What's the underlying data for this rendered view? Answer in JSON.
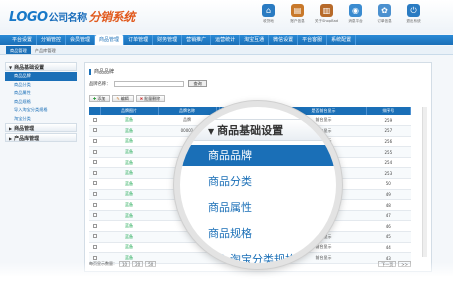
{
  "header": {
    "logo_main": "LOGO",
    "logo_company": "公司名称",
    "logo_system": "分销系统"
  },
  "top_icons": [
    {
      "label": "收货地",
      "icon": "home-icon",
      "color": "#2a7bc2",
      "glyph": "⌂"
    },
    {
      "label": "账户信息",
      "icon": "chart-icon",
      "color": "#c8782a",
      "glyph": "▤"
    },
    {
      "label": "关于ShopBad",
      "icon": "book-icon",
      "color": "#b76a2a",
      "glyph": "▥"
    },
    {
      "label": "消息平台",
      "icon": "globe-icon",
      "color": "#3a8bd0",
      "glyph": "◉"
    },
    {
      "label": "订单信息",
      "icon": "gear-icon",
      "color": "#4b90cf",
      "glyph": "✿"
    },
    {
      "label": "退出系统",
      "icon": "power-icon",
      "color": "#2a7bc2",
      "glyph": "⏻"
    }
  ],
  "nav": [
    "平台设置",
    "分销管控",
    "会员管理",
    "商品管理",
    "订单管理",
    "财务管理",
    "营销推广",
    "运营统计",
    "淘宝互通",
    "微信设置",
    "平台客服",
    "系统配置"
  ],
  "subnav": [
    "商品管理",
    "产品库管理"
  ],
  "sidebar": {
    "groups": [
      {
        "title": "商品基础设置",
        "items": [
          "商品品牌",
          "商品分类",
          "商品属性",
          "商品规格",
          "导入淘宝分类规格",
          "淘宝分类"
        ]
      },
      {
        "title": "商品管理",
        "items": []
      },
      {
        "title": "产品库管理",
        "items": []
      }
    ]
  },
  "main": {
    "title": "商品品牌",
    "search_label": "品牌名称：",
    "search_button": "查询",
    "toolbar": {
      "add": "添加",
      "edit": "编辑",
      "delete": "批量删除"
    },
    "columns": [
      "",
      "品牌图片",
      "品牌名称",
      "",
      "",
      "是否推荐",
      "是否前台显示",
      "排序号"
    ],
    "rows": [
      [
        "",
        "蓝备",
        "品牌",
        "",
        "",
        "推荐",
        "前台显示",
        "259"
      ],
      [
        "",
        "蓝备",
        "00001",
        "",
        "",
        "",
        "前台显示",
        "257"
      ],
      [
        "",
        "蓝备",
        "",
        "",
        "",
        "",
        "前台显示",
        "256"
      ],
      [
        "",
        "蓝备",
        "珊",
        "",
        "",
        "",
        "前台显示",
        "255"
      ],
      [
        "",
        "蓝备",
        "",
        "",
        "",
        "",
        "前台显示",
        "254"
      ],
      [
        "",
        "蓝备",
        "",
        "",
        "",
        "",
        "前台显示",
        "253"
      ],
      [
        "",
        "蓝备",
        "",
        "",
        "",
        "",
        "前台显示",
        "50"
      ],
      [
        "",
        "蓝备",
        "",
        "",
        "",
        "",
        "前台显示",
        "49"
      ],
      [
        "",
        "蓝备",
        "",
        "",
        "",
        "",
        "前台显示",
        "48"
      ],
      [
        "",
        "蓝备",
        "",
        "",
        "",
        "",
        "前台显示",
        "47"
      ],
      [
        "",
        "蓝备",
        "",
        "",
        "",
        "",
        "前台显示",
        "46"
      ],
      [
        "",
        "蓝备",
        "",
        "",
        "",
        "",
        "前台显示",
        "45"
      ],
      [
        "",
        "蓝备",
        "",
        "",
        "",
        "",
        "前台显示",
        "44"
      ],
      [
        "",
        "蓝备",
        "",
        "",
        "",
        "",
        "前台显示",
        "43"
      ]
    ],
    "pager": {
      "label": "每页显示数量：",
      "sizes": [
        "10",
        "20",
        "50"
      ],
      "next": "下一页",
      "go": ">>"
    }
  },
  "lens": {
    "header": "商品基础设置",
    "items": [
      "商品品牌",
      "商品分类",
      "商品属性",
      "商品规格",
      "导入淘宝分类规格"
    ]
  }
}
